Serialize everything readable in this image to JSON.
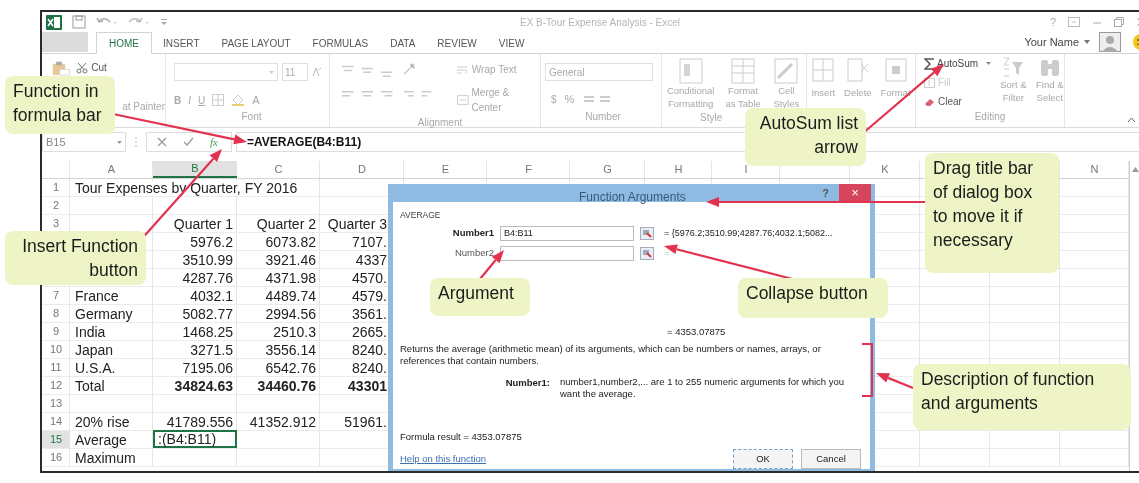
{
  "window": {
    "title": "EX B-Tour Expense Analysis - Excel",
    "help": "?"
  },
  "tabs": [
    {
      "label": "HOME",
      "selected": true
    },
    {
      "label": "INSERT",
      "selected": false
    },
    {
      "label": "PAGE LAYOUT",
      "selected": false
    },
    {
      "label": "FORMULAS",
      "selected": false
    },
    {
      "label": "DATA",
      "selected": false
    },
    {
      "label": "REVIEW",
      "selected": false
    },
    {
      "label": "VIEW",
      "selected": false
    }
  ],
  "account": {
    "name": "Your Name"
  },
  "ribbon": {
    "clipboard": {
      "cut": "Cut",
      "format_painter": "at Painter"
    },
    "font": {
      "label": "Font",
      "size": "11",
      "bold": "B",
      "italic": "I",
      "underline": "U",
      "font_color": "A"
    },
    "alignment": {
      "label": "Alignment",
      "wrap_text": "Wrap Text",
      "merge": "Merge & Center"
    },
    "number": {
      "label": "Number",
      "format": "General",
      "currency": "$",
      "percent": "%"
    },
    "styles": {
      "label": "Style",
      "conditional": "Conditional Formatting",
      "table": "Format as Table",
      "cell_styles": "Cell Styles"
    },
    "cells": {
      "insert": "Insert",
      "delete": "Delete",
      "format": "Format"
    },
    "editing": {
      "label": "Editing",
      "autosum": "AutoSum",
      "fill": "Fill",
      "clear": "Clear",
      "sort": "Sort & Filter",
      "find": "Find & Select"
    }
  },
  "formula_bar": {
    "name_box": "B15",
    "insert_function": "fx",
    "formula": "=AVERAGE(B4:B11)"
  },
  "sheet": {
    "columns": [
      {
        "label": "A",
        "selected": false
      },
      {
        "label": "B",
        "selected": true
      },
      {
        "label": "C",
        "selected": false
      },
      {
        "label": "D",
        "selected": false
      },
      {
        "label": "E",
        "selected": false
      },
      {
        "label": "F",
        "selected": false
      },
      {
        "label": "G",
        "selected": false
      },
      {
        "label": "H",
        "selected": false
      },
      {
        "label": "I",
        "selected": false
      },
      {
        "label": "K",
        "selected": false
      },
      {
        "label": "N",
        "selected": false
      }
    ],
    "rows": [
      {
        "number": "1",
        "a": "Tour Expenses by Quarter, FY 2016",
        "selected": false
      },
      {
        "number": "2",
        "selected": false
      },
      {
        "number": "3",
        "b": "Quarter 1",
        "c": "Quarter 2",
        "d": "Quarter 3",
        "bold": false,
        "selected": false
      },
      {
        "b": "5976.2",
        "c": "6073.82",
        "d": "7107.",
        "bold": false,
        "selected": false
      },
      {
        "b": "3510.99",
        "c": "3921.46",
        "d": "4337",
        "bold": false,
        "selected": false
      },
      {
        "b": "4287.76",
        "c": "4371.98",
        "d": "4570.",
        "bold": false,
        "selected": false
      },
      {
        "number": "7",
        "a": "France",
        "b": "4032.1",
        "c": "4489.74",
        "d": "4579.",
        "bold": false,
        "selected": false
      },
      {
        "number": "8",
        "a": "Germany",
        "b": "5082.77",
        "c": "2994.56",
        "d": "3561.",
        "bold": false,
        "selected": false
      },
      {
        "number": "9",
        "a": "India",
        "b": "1468.25",
        "c": "2510.3",
        "d": "2665.",
        "bold": false,
        "selected": false
      },
      {
        "number": "10",
        "a": "Japan",
        "b": "3271.5",
        "c": "3556.14",
        "d": "8240.",
        "bold": false,
        "selected": false
      },
      {
        "number": "11",
        "a": "U.S.A.",
        "b": "7195.06",
        "c": "6542.76",
        "d": "8240.",
        "bold": false,
        "selected": false
      },
      {
        "number": "12",
        "a": "Total",
        "b": "34824.63",
        "c": "34460.76",
        "d": "43301",
        "bold": true,
        "selected": false
      },
      {
        "number": "13",
        "selected": false
      },
      {
        "number": "14",
        "a": "20% rise",
        "b": "41789.556",
        "c": "41352.912",
        "d": "51961.",
        "bold": false,
        "selected": false
      },
      {
        "number": "15",
        "a": "Average",
        "b": ":(B4:B11)",
        "bold": false,
        "selected": true
      },
      {
        "number": "16",
        "a": "Maximum",
        "selected": false
      }
    ]
  },
  "dialog": {
    "title": "Function Arguments",
    "help": "?",
    "close": "×",
    "function": "AVERAGE",
    "arguments": [
      {
        "label": "Number1",
        "value": "B4:B11",
        "result": "= {5976.2;3510.99;4287.76;4032.1;5082...",
        "filled": true
      },
      {
        "label": "Number2",
        "result": "=",
        "filled": false
      }
    ],
    "result": "= 4353.07875",
    "description": "Returns the average (arithmetic mean) of its arguments, which can be numbers or names, arrays, or references that contain numbers.",
    "argument_label": "Number1:",
    "argument_help": "number1,number2,... are 1 to 255 numeric arguments for which you want the average.",
    "formula_result": "Formula result =  4353.07875",
    "help_link": "Help on this function",
    "buttons": [
      "OK",
      "Cancel"
    ]
  },
  "callouts": [
    "Function in formula bar",
    "Insert Function button",
    "AutoSum list arrow",
    "Drag title bar of dialog box to move it if necessary",
    "Argument",
    "Collapse button",
    "Description of function and arguments"
  ]
}
